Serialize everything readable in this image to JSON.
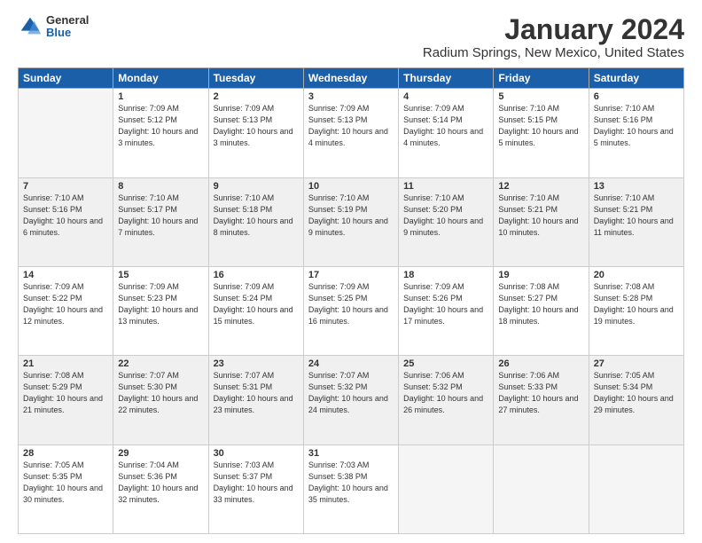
{
  "logo": {
    "general": "General",
    "blue": "Blue"
  },
  "title": "January 2024",
  "location": "Radium Springs, New Mexico, United States",
  "headers": [
    "Sunday",
    "Monday",
    "Tuesday",
    "Wednesday",
    "Thursday",
    "Friday",
    "Saturday"
  ],
  "weeks": [
    [
      {
        "day": "",
        "empty": true
      },
      {
        "day": "1",
        "sunrise": "7:09 AM",
        "sunset": "5:12 PM",
        "daylight": "10 hours and 3 minutes."
      },
      {
        "day": "2",
        "sunrise": "7:09 AM",
        "sunset": "5:13 PM",
        "daylight": "10 hours and 3 minutes."
      },
      {
        "day": "3",
        "sunrise": "7:09 AM",
        "sunset": "5:13 PM",
        "daylight": "10 hours and 4 minutes."
      },
      {
        "day": "4",
        "sunrise": "7:09 AM",
        "sunset": "5:14 PM",
        "daylight": "10 hours and 4 minutes."
      },
      {
        "day": "5",
        "sunrise": "7:10 AM",
        "sunset": "5:15 PM",
        "daylight": "10 hours and 5 minutes."
      },
      {
        "day": "6",
        "sunrise": "7:10 AM",
        "sunset": "5:16 PM",
        "daylight": "10 hours and 5 minutes."
      }
    ],
    [
      {
        "day": "7",
        "sunrise": "7:10 AM",
        "sunset": "5:16 PM",
        "daylight": "10 hours and 6 minutes."
      },
      {
        "day": "8",
        "sunrise": "7:10 AM",
        "sunset": "5:17 PM",
        "daylight": "10 hours and 7 minutes."
      },
      {
        "day": "9",
        "sunrise": "7:10 AM",
        "sunset": "5:18 PM",
        "daylight": "10 hours and 8 minutes."
      },
      {
        "day": "10",
        "sunrise": "7:10 AM",
        "sunset": "5:19 PM",
        "daylight": "10 hours and 9 minutes."
      },
      {
        "day": "11",
        "sunrise": "7:10 AM",
        "sunset": "5:20 PM",
        "daylight": "10 hours and 9 minutes."
      },
      {
        "day": "12",
        "sunrise": "7:10 AM",
        "sunset": "5:21 PM",
        "daylight": "10 hours and 10 minutes."
      },
      {
        "day": "13",
        "sunrise": "7:10 AM",
        "sunset": "5:21 PM",
        "daylight": "10 hours and 11 minutes."
      }
    ],
    [
      {
        "day": "14",
        "sunrise": "7:09 AM",
        "sunset": "5:22 PM",
        "daylight": "10 hours and 12 minutes."
      },
      {
        "day": "15",
        "sunrise": "7:09 AM",
        "sunset": "5:23 PM",
        "daylight": "10 hours and 13 minutes."
      },
      {
        "day": "16",
        "sunrise": "7:09 AM",
        "sunset": "5:24 PM",
        "daylight": "10 hours and 15 minutes."
      },
      {
        "day": "17",
        "sunrise": "7:09 AM",
        "sunset": "5:25 PM",
        "daylight": "10 hours and 16 minutes."
      },
      {
        "day": "18",
        "sunrise": "7:09 AM",
        "sunset": "5:26 PM",
        "daylight": "10 hours and 17 minutes."
      },
      {
        "day": "19",
        "sunrise": "7:08 AM",
        "sunset": "5:27 PM",
        "daylight": "10 hours and 18 minutes."
      },
      {
        "day": "20",
        "sunrise": "7:08 AM",
        "sunset": "5:28 PM",
        "daylight": "10 hours and 19 minutes."
      }
    ],
    [
      {
        "day": "21",
        "sunrise": "7:08 AM",
        "sunset": "5:29 PM",
        "daylight": "10 hours and 21 minutes."
      },
      {
        "day": "22",
        "sunrise": "7:07 AM",
        "sunset": "5:30 PM",
        "daylight": "10 hours and 22 minutes."
      },
      {
        "day": "23",
        "sunrise": "7:07 AM",
        "sunset": "5:31 PM",
        "daylight": "10 hours and 23 minutes."
      },
      {
        "day": "24",
        "sunrise": "7:07 AM",
        "sunset": "5:32 PM",
        "daylight": "10 hours and 24 minutes."
      },
      {
        "day": "25",
        "sunrise": "7:06 AM",
        "sunset": "5:32 PM",
        "daylight": "10 hours and 26 minutes."
      },
      {
        "day": "26",
        "sunrise": "7:06 AM",
        "sunset": "5:33 PM",
        "daylight": "10 hours and 27 minutes."
      },
      {
        "day": "27",
        "sunrise": "7:05 AM",
        "sunset": "5:34 PM",
        "daylight": "10 hours and 29 minutes."
      }
    ],
    [
      {
        "day": "28",
        "sunrise": "7:05 AM",
        "sunset": "5:35 PM",
        "daylight": "10 hours and 30 minutes."
      },
      {
        "day": "29",
        "sunrise": "7:04 AM",
        "sunset": "5:36 PM",
        "daylight": "10 hours and 32 minutes."
      },
      {
        "day": "30",
        "sunrise": "7:03 AM",
        "sunset": "5:37 PM",
        "daylight": "10 hours and 33 minutes."
      },
      {
        "day": "31",
        "sunrise": "7:03 AM",
        "sunset": "5:38 PM",
        "daylight": "10 hours and 35 minutes."
      },
      {
        "day": "",
        "empty": true
      },
      {
        "day": "",
        "empty": true
      },
      {
        "day": "",
        "empty": true
      }
    ]
  ]
}
